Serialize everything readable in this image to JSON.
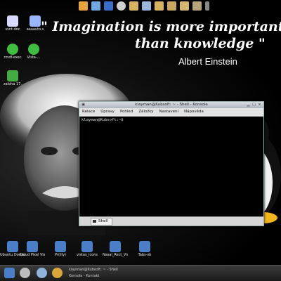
{
  "quote": {
    "line1": "\" Imagination is more important",
    "line2": "than knowledge \"",
    "author": "Albert Einstein"
  },
  "desktop_icons": {
    "top_left": [
      {
        "label": "ssnt.doc",
        "icon": "document-icon",
        "color": "#d8d8ff"
      },
      {
        "label": "aaaauto.s",
        "icon": "document-icon",
        "color": "#9ab6ff"
      },
      {
        "label": "rmdf-exec",
        "icon": "green-disc-icon",
        "color": "#3fbf3f"
      },
      {
        "label": "Vista-...",
        "icon": "green-disc-icon",
        "color": "#3fbf3f"
      },
      {
        "label": "zaloha 17.",
        "icon": "chart-doc-icon",
        "color": "#44aa44"
      }
    ],
    "bottom": [
      {
        "label": "Ubuntu Dorian",
        "icon": "folder-icon"
      },
      {
        "label": "Cloud Pixel Vistapl",
        "icon": "folder-icon"
      },
      {
        "label": "Pr(illy)",
        "icon": "folder-icon"
      },
      {
        "label": "vistas_icons",
        "icon": "folder-icon"
      },
      {
        "label": "Nasal_Rect_Vista_Icons",
        "icon": "folder-icon"
      },
      {
        "label": "Tabs-sb",
        "icon": "folder-icon"
      }
    ]
  },
  "konsole": {
    "title": "klayman@Kubsoft: ~ - Shell - Konsole",
    "menu": [
      "Relace",
      "Úpravy",
      "Pohled",
      "Záložky",
      "Nastavení",
      "Nápověda"
    ],
    "prompt": "klayman@Kubsoft:~$",
    "tab_label": "Shell"
  },
  "panel": {
    "task1": "klayman@Kubsoft: ~ - Shell",
    "task2": "Konsole - Kontakt"
  },
  "colors": {
    "folder": "#4a7ec8",
    "panel": "#2a2a2a"
  }
}
